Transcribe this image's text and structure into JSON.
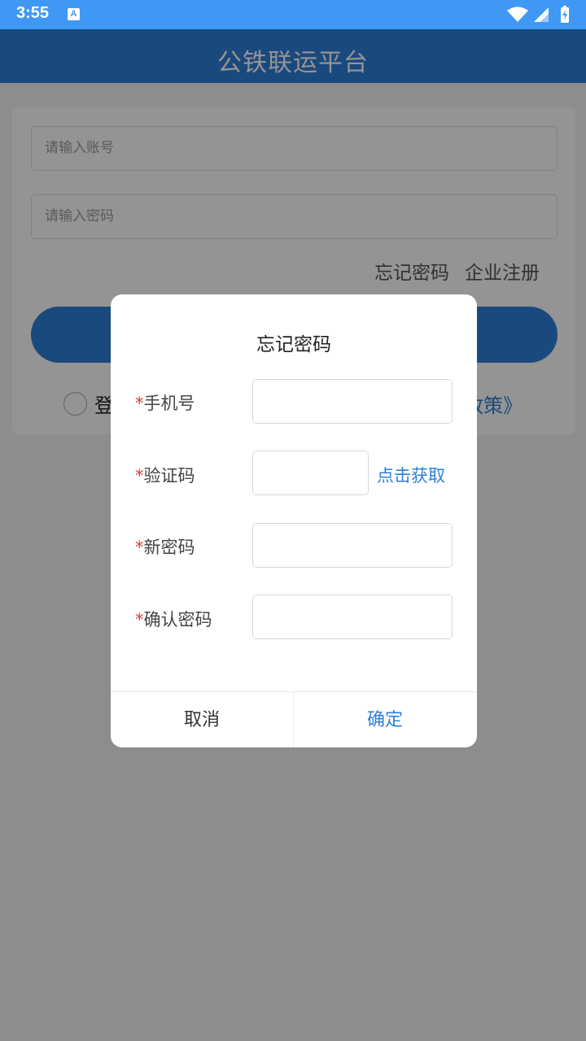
{
  "status_bar": {
    "time": "3:55",
    "notification_icon_letter": "A",
    "icons": [
      "notification-a-icon",
      "wifi-icon",
      "signal-icon",
      "battery-charging-icon"
    ]
  },
  "header": {
    "title": "公铁联运平台"
  },
  "login": {
    "account_placeholder": "请输入账号",
    "password_placeholder": "请输入密码",
    "forgot_password": "忘记密码",
    "register": "企业注册",
    "agree_prefix": "登",
    "policy_suffix": "政策》"
  },
  "dialog": {
    "title": "忘记密码",
    "required_mark": "*",
    "fields": {
      "phone": "手机号",
      "code": "验证码",
      "new_password": "新密码",
      "confirm_password": "确认密码"
    },
    "get_code": "点击获取",
    "cancel": "取消",
    "confirm": "确定"
  },
  "colors": {
    "status_bar": "#3f98f4",
    "header": "#2e7ed8",
    "accent": "#2e7ed8",
    "required": "#e03b3b"
  }
}
